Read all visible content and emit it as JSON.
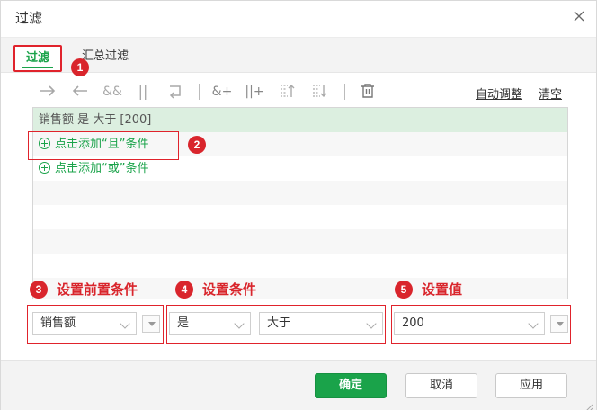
{
  "dialog": {
    "title": "过滤",
    "close_icon": "close-icon"
  },
  "tabs": [
    {
      "label": "过滤",
      "active": true
    },
    {
      "label": "汇总过滤",
      "active": false
    }
  ],
  "toolbar": {
    "icons": [
      "arrow-right-icon",
      "arrow-left-icon",
      "and-icon",
      "or-icon",
      "undo-wrap-icon",
      "add-and-icon",
      "add-or-icon",
      "move-up-icon",
      "move-down-icon",
      "delete-icon"
    ],
    "glyphs": {
      "and": "&&",
      "or": "||",
      "add_and": "&+",
      "add_or": "||+"
    },
    "auto_adjust": "自动调整",
    "clear": "清空"
  },
  "conditions": {
    "selected_row": "销售额 是 大于 [200]",
    "add_and": "点击添加“且”条件",
    "add_or": "点击添加“或”条件"
  },
  "annotations": {
    "badge1": "1",
    "badge2": "2",
    "badge3": "3",
    "badge4": "4",
    "badge5": "5",
    "label3": "设置前置条件",
    "label4": "设置条件",
    "label5": "设置值"
  },
  "editors": {
    "field": "销售额",
    "operator": "是",
    "condition": "大于",
    "value": "200"
  },
  "footer": {
    "ok": "确定",
    "cancel": "取消",
    "apply": "应用"
  },
  "colors": {
    "accent": "#1aa34a",
    "annotation_red": "#d9252c",
    "selected_row_bg": "#dcefe0"
  }
}
